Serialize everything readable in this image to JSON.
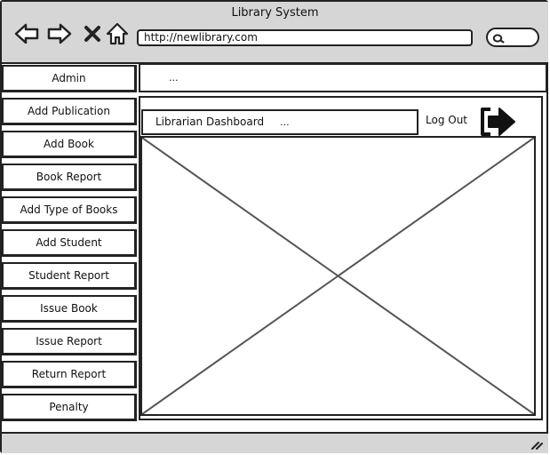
{
  "window": {
    "title": "Library System"
  },
  "browser": {
    "url": "http://newlibrary.com"
  },
  "sidebar": {
    "items": [
      {
        "label": "Admin"
      },
      {
        "label": "Add Publication"
      },
      {
        "label": "Add Book"
      },
      {
        "label": "Book Report"
      },
      {
        "label": "Add Type of Books"
      },
      {
        "label": "Add Student"
      },
      {
        "label": "Student Report"
      },
      {
        "label": "Issue Book"
      },
      {
        "label": "Issue Report"
      },
      {
        "label": "Return Report"
      },
      {
        "label": "Penalty"
      }
    ]
  },
  "admin_bar": {
    "text": "..."
  },
  "dashboard": {
    "title": "Librarian Dashboard",
    "ellipsis": "...",
    "logout_label": "Log Out"
  },
  "icons": {
    "nav": [
      "back-arrow-icon",
      "forward-arrow-icon",
      "close-icon",
      "home-icon"
    ],
    "search": "search-icon",
    "logout": "logout-arrow-icon",
    "resize": "resize-grip-icon"
  }
}
